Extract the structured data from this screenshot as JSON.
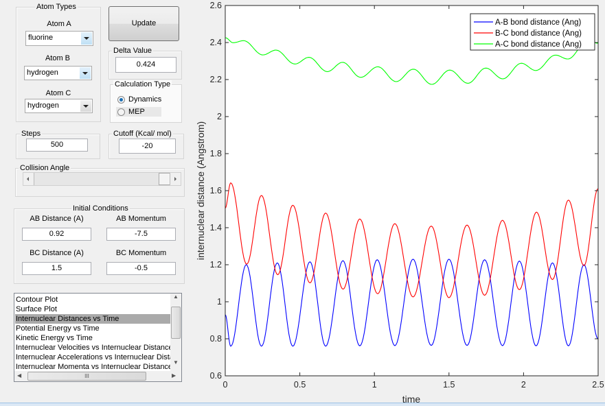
{
  "atom_types": {
    "title": "Atom Types",
    "atom_a": {
      "label": "Atom A",
      "value": "fluorine"
    },
    "atom_b": {
      "label": "Atom B",
      "value": "hydrogen"
    },
    "atom_c": {
      "label": "Atom C",
      "value": "hydrogen"
    }
  },
  "update_label": "Update",
  "delta": {
    "title": "Delta Value",
    "value": "0.424"
  },
  "calc_type": {
    "title": "Calculation Type",
    "options": [
      "Dynamics",
      "MEP"
    ],
    "selected": "Dynamics"
  },
  "steps": {
    "title": "Steps",
    "value": "500"
  },
  "cutoff": {
    "title": "Cutoff (Kcal/ mol)",
    "value": "-20"
  },
  "collision_angle": {
    "title": "Collision Angle",
    "slider_fraction": 1.0
  },
  "initial_conditions": {
    "title": "Initial Conditions",
    "ab_distance": {
      "label": "AB Distance (A)",
      "value": "0.92"
    },
    "ab_momentum": {
      "label": "AB Momentum",
      "value": "-7.5"
    },
    "bc_distance": {
      "label": "BC Distance (A)",
      "value": "1.5"
    },
    "bc_momentum": {
      "label": "BC Momentum",
      "value": "-0.5"
    }
  },
  "plot_list": {
    "items": [
      "Contour Plot",
      "Surface Plot",
      "Internuclear Distances vs Time",
      "Potential Energy vs Time",
      "Kinetic Energy vs Time",
      "Internuclear Velocities vs Internuclear Distance",
      "Internuclear Accelerations vs Internuclear Distance",
      "Internuclear Momenta vs Internuclear Distance"
    ],
    "selected_index": 2,
    "hscroll_grip": "III"
  },
  "chart_data": {
    "type": "line",
    "xlabel": "time",
    "ylabel": "internuclear distance (Angstrom)",
    "xlim": [
      0,
      2.5
    ],
    "ylim": [
      0.6,
      2.6
    ],
    "xticks": [
      "0",
      "0.5",
      "1",
      "1.5",
      "2",
      "2.5"
    ],
    "yticks": [
      "0.6",
      "0.8",
      "1",
      "1.2",
      "1.4",
      "1.6",
      "1.8",
      "2",
      "2.2",
      "2.4",
      "2.6"
    ],
    "grid": false,
    "legend_position": "top-right",
    "series": [
      {
        "name": "A-B bond distance (Ang)",
        "color": "#0000ff",
        "points": [
          [
            0,
            0.93
          ],
          [
            0.037,
            0.76
          ],
          [
            0.141,
            1.2
          ],
          [
            0.243,
            0.76
          ],
          [
            0.349,
            1.21
          ],
          [
            0.453,
            0.76
          ],
          [
            0.568,
            1.216
          ],
          [
            0.673,
            0.76
          ],
          [
            0.789,
            1.222
          ],
          [
            0.902,
            0.762
          ],
          [
            1.019,
            1.227
          ],
          [
            1.137,
            0.763
          ],
          [
            1.259,
            1.23
          ],
          [
            1.381,
            0.764
          ],
          [
            1.5,
            1.23
          ],
          [
            1.621,
            0.764
          ],
          [
            1.739,
            1.227
          ],
          [
            1.859,
            0.763
          ],
          [
            1.972,
            1.22
          ],
          [
            2.084,
            0.762
          ],
          [
            2.194,
            1.21
          ],
          [
            2.301,
            0.762
          ],
          [
            2.405,
            1.2
          ],
          [
            2.5,
            0.8
          ]
        ]
      },
      {
        "name": "B-C bond distance (Ang)",
        "color": "#ff0000",
        "points": [
          [
            0,
            1.506
          ],
          [
            0.037,
            1.642
          ],
          [
            0.144,
            1.203
          ],
          [
            0.243,
            1.574
          ],
          [
            0.352,
            1.146
          ],
          [
            0.453,
            1.521
          ],
          [
            0.568,
            1.102
          ],
          [
            0.673,
            1.479
          ],
          [
            0.79,
            1.068
          ],
          [
            0.902,
            1.447
          ],
          [
            1.022,
            1.043
          ],
          [
            1.137,
            1.422
          ],
          [
            1.259,
            1.026
          ],
          [
            1.381,
            1.409
          ],
          [
            1.5,
            1.022
          ],
          [
            1.621,
            1.414
          ],
          [
            1.739,
            1.035
          ],
          [
            1.859,
            1.44
          ],
          [
            1.972,
            1.065
          ],
          [
            2.087,
            1.484
          ],
          [
            2.194,
            1.12
          ],
          [
            2.301,
            1.549
          ],
          [
            2.405,
            1.195
          ],
          [
            2.5,
            1.611
          ]
        ]
      },
      {
        "name": "A-C bond distance (Ang)",
        "color": "#00ff00",
        "points": [
          [
            0,
            2.426
          ],
          [
            0.053,
            2.399
          ],
          [
            0.123,
            2.41
          ],
          [
            0.252,
            2.333
          ],
          [
            0.34,
            2.359
          ],
          [
            0.467,
            2.284
          ],
          [
            0.561,
            2.32
          ],
          [
            0.684,
            2.243
          ],
          [
            0.787,
            2.293
          ],
          [
            0.908,
            2.212
          ],
          [
            1.023,
            2.269
          ],
          [
            1.146,
            2.189
          ],
          [
            1.261,
            2.256
          ],
          [
            1.385,
            2.174
          ],
          [
            1.505,
            2.251
          ],
          [
            1.627,
            2.18
          ],
          [
            1.747,
            2.262
          ],
          [
            1.861,
            2.204
          ],
          [
            1.985,
            2.288
          ],
          [
            2.082,
            2.249
          ],
          [
            2.214,
            2.332
          ],
          [
            2.297,
            2.311
          ],
          [
            2.43,
            2.41
          ],
          [
            2.5,
            2.396
          ]
        ]
      }
    ]
  }
}
